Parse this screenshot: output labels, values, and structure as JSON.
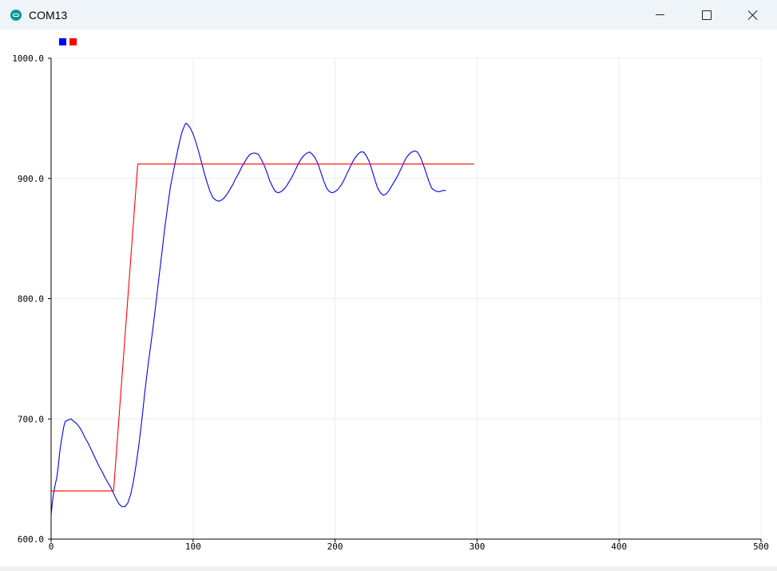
{
  "window": {
    "title": "COM13",
    "app_icon": "arduino-icon",
    "controls": [
      "minimize-icon",
      "maximize-icon",
      "close-icon"
    ]
  },
  "legend": {
    "colors": [
      "#0000ff",
      "#ff0000"
    ]
  },
  "chart_data": {
    "type": "line",
    "grid": true,
    "xlim": [
      0,
      500
    ],
    "ylim": [
      600,
      1000
    ],
    "x_ticks": [
      "0",
      "100",
      "200",
      "300",
      "400",
      "500"
    ],
    "y_ticks": [
      "600.0",
      "700.0",
      "800.0",
      "900.0",
      "1000.0"
    ],
    "series": [
      {
        "color": "#0000ff",
        "points": [
          [
            0,
            620
          ],
          [
            1,
            632
          ],
          [
            2,
            640
          ],
          [
            3,
            646
          ],
          [
            4,
            651
          ],
          [
            5,
            660
          ],
          [
            6,
            672
          ],
          [
            7,
            680
          ],
          [
            8,
            687
          ],
          [
            9,
            694
          ],
          [
            10,
            698
          ],
          [
            12,
            699
          ],
          [
            14,
            700
          ],
          [
            16,
            698
          ],
          [
            18,
            696
          ],
          [
            20,
            693
          ],
          [
            22,
            689
          ],
          [
            24,
            684
          ],
          [
            26,
            680
          ],
          [
            28,
            675
          ],
          [
            30,
            670
          ],
          [
            32,
            665
          ],
          [
            34,
            660
          ],
          [
            36,
            656
          ],
          [
            38,
            651
          ],
          [
            40,
            647
          ],
          [
            42,
            643
          ],
          [
            44,
            638
          ],
          [
            46,
            633
          ],
          [
            48,
            629
          ],
          [
            50,
            627
          ],
          [
            52,
            627
          ],
          [
            54,
            630
          ],
          [
            56,
            637
          ],
          [
            58,
            648
          ],
          [
            60,
            663
          ],
          [
            62,
            680
          ],
          [
            64,
            700
          ],
          [
            66,
            722
          ],
          [
            68,
            742
          ],
          [
            70,
            760
          ],
          [
            72,
            778
          ],
          [
            74,
            798
          ],
          [
            76,
            818
          ],
          [
            78,
            838
          ],
          [
            80,
            858
          ],
          [
            82,
            876
          ],
          [
            84,
            893
          ],
          [
            86,
            905
          ],
          [
            88,
            917
          ],
          [
            90,
            928
          ],
          [
            92,
            938
          ],
          [
            94,
            944
          ],
          [
            95,
            946
          ],
          [
            96,
            945
          ],
          [
            98,
            942
          ],
          [
            100,
            937
          ],
          [
            102,
            930
          ],
          [
            104,
            922
          ],
          [
            106,
            913
          ],
          [
            108,
            904
          ],
          [
            110,
            896
          ],
          [
            112,
            889
          ],
          [
            114,
            884
          ],
          [
            116,
            882
          ],
          [
            118,
            881
          ],
          [
            120,
            882
          ],
          [
            122,
            884
          ],
          [
            124,
            887
          ],
          [
            126,
            891
          ],
          [
            128,
            895
          ],
          [
            130,
            900
          ],
          [
            132,
            904
          ],
          [
            134,
            909
          ],
          [
            136,
            913
          ],
          [
            138,
            917
          ],
          [
            140,
            920
          ],
          [
            142,
            921
          ],
          [
            144,
            921
          ],
          [
            146,
            920
          ],
          [
            148,
            916
          ],
          [
            150,
            911
          ],
          [
            152,
            905
          ],
          [
            154,
            898
          ],
          [
            156,
            893
          ],
          [
            158,
            889
          ],
          [
            160,
            888
          ],
          [
            162,
            889
          ],
          [
            164,
            891
          ],
          [
            166,
            894
          ],
          [
            168,
            898
          ],
          [
            170,
            902
          ],
          [
            172,
            907
          ],
          [
            174,
            912
          ],
          [
            176,
            916
          ],
          [
            178,
            919
          ],
          [
            180,
            921
          ],
          [
            182,
            922
          ],
          [
            184,
            920
          ],
          [
            186,
            917
          ],
          [
            188,
            912
          ],
          [
            190,
            905
          ],
          [
            192,
            898
          ],
          [
            194,
            892
          ],
          [
            196,
            889
          ],
          [
            198,
            888
          ],
          [
            200,
            889
          ],
          [
            202,
            891
          ],
          [
            204,
            894
          ],
          [
            206,
            898
          ],
          [
            208,
            903
          ],
          [
            210,
            908
          ],
          [
            212,
            913
          ],
          [
            214,
            917
          ],
          [
            216,
            920
          ],
          [
            218,
            922
          ],
          [
            220,
            922
          ],
          [
            222,
            919
          ],
          [
            224,
            914
          ],
          [
            226,
            907
          ],
          [
            228,
            899
          ],
          [
            230,
            892
          ],
          [
            232,
            888
          ],
          [
            234,
            886
          ],
          [
            236,
            887
          ],
          [
            238,
            890
          ],
          [
            240,
            894
          ],
          [
            242,
            898
          ],
          [
            244,
            902
          ],
          [
            246,
            907
          ],
          [
            248,
            912
          ],
          [
            250,
            917
          ],
          [
            252,
            920
          ],
          [
            254,
            922
          ],
          [
            256,
            923
          ],
          [
            258,
            922
          ],
          [
            260,
            918
          ],
          [
            262,
            912
          ],
          [
            264,
            905
          ],
          [
            266,
            898
          ],
          [
            268,
            892
          ],
          [
            270,
            890
          ],
          [
            272,
            889
          ],
          [
            274,
            889
          ],
          [
            276,
            890
          ],
          [
            278,
            890
          ]
        ]
      },
      {
        "color": "#ff0000",
        "points": [
          [
            0,
            640
          ],
          [
            44,
            640
          ],
          [
            61,
            912
          ],
          [
            298,
            912
          ]
        ]
      }
    ]
  }
}
